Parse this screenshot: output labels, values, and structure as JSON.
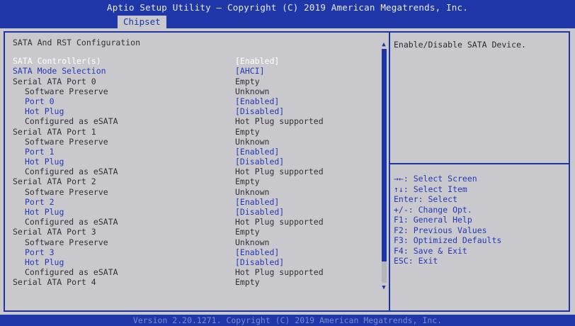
{
  "header": {
    "title": "Aptio Setup Utility – Copyright (C) 2019 American Megatrends, Inc.",
    "active_tab": "Chipset"
  },
  "main": {
    "heading": "SATA And RST Configuration",
    "rows": [
      {
        "label": "SATA Controller(s)",
        "value": "[Enabled]",
        "indent": 0,
        "type": "selected"
      },
      {
        "label": "SATA Mode Selection",
        "value": "[AHCI]",
        "indent": 0,
        "type": "link"
      },
      {
        "label": "Serial ATA Port 0",
        "value": "Empty",
        "indent": 0,
        "type": "static"
      },
      {
        "label": "Software Preserve",
        "value": "Unknown",
        "indent": 1,
        "type": "static"
      },
      {
        "label": "Port 0",
        "value": "[Enabled]",
        "indent": 1,
        "type": "link"
      },
      {
        "label": "Hot Plug",
        "value": "[Disabled]",
        "indent": 1,
        "type": "link"
      },
      {
        "label": "Configured as eSATA",
        "value": "Hot Plug supported",
        "indent": 1,
        "type": "static"
      },
      {
        "label": "Serial ATA Port 1",
        "value": "Empty",
        "indent": 0,
        "type": "static"
      },
      {
        "label": "Software Preserve",
        "value": "Unknown",
        "indent": 1,
        "type": "static"
      },
      {
        "label": "Port 1",
        "value": "[Enabled]",
        "indent": 1,
        "type": "link"
      },
      {
        "label": "Hot Plug",
        "value": "[Disabled]",
        "indent": 1,
        "type": "link"
      },
      {
        "label": "Configured as eSATA",
        "value": "Hot Plug supported",
        "indent": 1,
        "type": "static"
      },
      {
        "label": "Serial ATA Port 2",
        "value": "Empty",
        "indent": 0,
        "type": "static"
      },
      {
        "label": "Software Preserve",
        "value": "Unknown",
        "indent": 1,
        "type": "static"
      },
      {
        "label": "Port 2",
        "value": "[Enabled]",
        "indent": 1,
        "type": "link"
      },
      {
        "label": "Hot Plug",
        "value": "[Disabled]",
        "indent": 1,
        "type": "link"
      },
      {
        "label": "Configured as eSATA",
        "value": "Hot Plug supported",
        "indent": 1,
        "type": "static"
      },
      {
        "label": "Serial ATA Port 3",
        "value": "Empty",
        "indent": 0,
        "type": "static"
      },
      {
        "label": "Software Preserve",
        "value": "Unknown",
        "indent": 1,
        "type": "static"
      },
      {
        "label": "Port 3",
        "value": "[Enabled]",
        "indent": 1,
        "type": "link"
      },
      {
        "label": "Hot Plug",
        "value": "[Disabled]",
        "indent": 1,
        "type": "link"
      },
      {
        "label": "Configured as eSATA",
        "value": "Hot Plug supported",
        "indent": 1,
        "type": "static"
      },
      {
        "label": "Serial ATA Port 4",
        "value": "Empty",
        "indent": 0,
        "type": "static"
      }
    ]
  },
  "help": {
    "description": "Enable/Disable SATA Device.",
    "keys": [
      "→←: Select Screen",
      "↑↓: Select Item",
      "Enter: Select",
      "+/-: Change Opt.",
      "F1: General Help",
      "F2: Previous Values",
      "F3: Optimized Defaults",
      "F4: Save & Exit",
      "ESC: Exit"
    ]
  },
  "scrollbar": {
    "up_icon": "▲",
    "down_icon": "▼"
  },
  "footer": {
    "text": "Version 2.20.1271. Copyright (C) 2019 American Megatrends, Inc."
  },
  "colors": {
    "header_bg": "#1f37a8",
    "panel_bg": "#c9c9cd",
    "link": "#2438b8",
    "selected": "#ffffff",
    "static": "#303036"
  }
}
